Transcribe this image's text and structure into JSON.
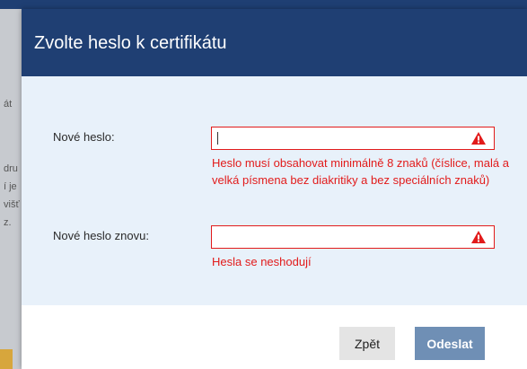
{
  "background": {
    "fragments": [
      "át",
      "dru",
      "í je",
      "višť",
      "z."
    ]
  },
  "dialog": {
    "title": "Zvolte heslo k certifikátu",
    "fields": [
      {
        "label": "Nové heslo:",
        "value": "",
        "error": "Heslo musí obsahovat minimálně 8 znaků (číslice, malá a velká písmena bez diakritiky a bez speciálních znaků)",
        "icon": "warning-icon"
      },
      {
        "label": "Nové heslo znovu:",
        "value": "",
        "error": "Hesla se neshodují",
        "icon": "warning-icon"
      }
    ],
    "buttons": {
      "back": "Zpět",
      "send": "Odeslat"
    }
  },
  "colors": {
    "header": "#1f3f73",
    "body": "#e8f1fa",
    "error": "#e21b1b",
    "primary_button": "#6f8fb5"
  }
}
